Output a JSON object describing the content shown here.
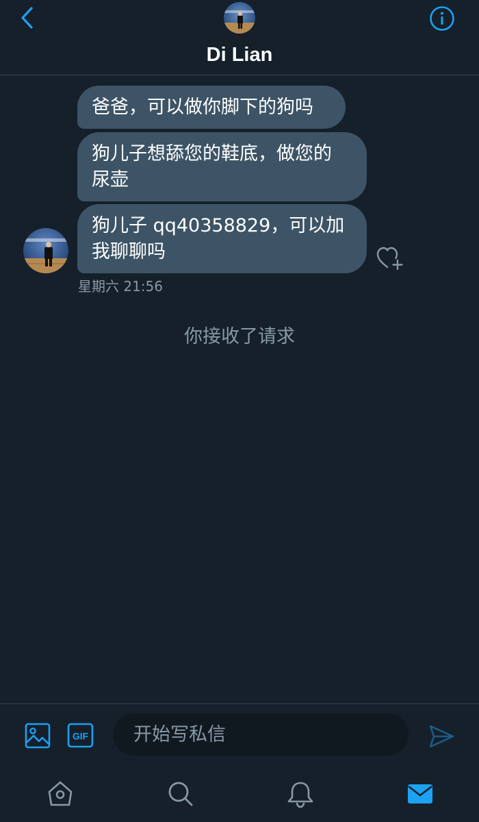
{
  "header": {
    "title": "Di Lian",
    "back_icon": "chevron-left-icon",
    "info_icon": "info-circle-icon"
  },
  "messages": [
    {
      "text": "爸爸，可以做你脚下的狗吗"
    },
    {
      "text": "狗儿子想舔您的鞋底，做您的\n尿壶"
    },
    {
      "text": "狗儿子 qq40358829，可以加\n我聊聊吗"
    }
  ],
  "timestamp": "星期六 21:56",
  "system_message": "你接收了请求",
  "composer": {
    "placeholder": "开始写私信",
    "image_icon": "image-icon",
    "gif_label": "GIF",
    "send_icon": "send-icon"
  },
  "tabs": [
    {
      "name": "home",
      "icon": "home-icon"
    },
    {
      "name": "search",
      "icon": "search-icon"
    },
    {
      "name": "notifications",
      "icon": "bell-icon"
    },
    {
      "name": "messages",
      "icon": "mail-icon",
      "active": true
    }
  ],
  "colors": {
    "background": "#15202b",
    "bubble": "#3d5466",
    "accent": "#1da1f2",
    "muted": "#8899a6",
    "divider": "#38444d"
  }
}
